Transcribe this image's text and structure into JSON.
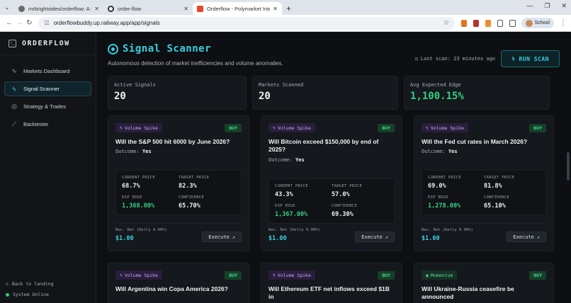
{
  "browser": {
    "tabs": [
      {
        "title": "mrbrightsides/orderflow: A live",
        "active": false,
        "fav_color": "#6b6b6b"
      },
      {
        "title": "order-flow",
        "active": false,
        "fav_color": "#333333"
      },
      {
        "title": "Orderflow - Polymarket Intellig",
        "active": true,
        "fav_color": "#e8452a"
      }
    ],
    "url": "orderflowbuddy.up.railway.app/app/signals",
    "profile": "School"
  },
  "sidebar": {
    "brand": "ORDERFLOW",
    "items": [
      {
        "label": "Markets Dashboard",
        "icon": "activity-icon",
        "glyph": "∿",
        "active": false
      },
      {
        "label": "Signal Scanner",
        "icon": "zap-icon",
        "glyph": "ϟ",
        "active": true
      },
      {
        "label": "Strategy & Trades",
        "icon": "target-icon",
        "glyph": "◎",
        "active": false
      },
      {
        "label": "Backtester",
        "icon": "chart-icon",
        "glyph": "⟋",
        "active": false
      }
    ],
    "back_label": "Back to landing",
    "status_label": "System Online"
  },
  "header": {
    "title": "Signal Scanner",
    "subtitle": "Autonomous detection of market inefficiencies and volume anomalies.",
    "last_scan": "Last scan: 23 minutes ago",
    "run_label": "RUN SCAN"
  },
  "stats": [
    {
      "label": "Active Signals",
      "value": "20",
      "green": false
    },
    {
      "label": "Markets Scanned",
      "value": "20",
      "green": false
    },
    {
      "label": "Avg Expected Edge",
      "value": "1,100.15%",
      "green": true
    }
  ],
  "labels": {
    "current_price": "CURRENT PRICE",
    "target_price": "TARGET PRICE",
    "exp_edge": "EXP EDGE",
    "confidence": "CONFIDENCE",
    "rec_bet": "Rec. Bet (Kelly 0.00%)",
    "execute": "Execute",
    "outcome": "Outcome:"
  },
  "cards": [
    {
      "badge": "Volume Spike",
      "type": "vol",
      "action": "BUY",
      "question": "Will the S&P 500 hit 6000 by June 2026?",
      "outcome": "Yes",
      "current": "68.7%",
      "target": "82.3%",
      "edge": "1,368.00%",
      "confidence": "65.70%",
      "bet": "$1.00"
    },
    {
      "badge": "Volume Spike",
      "type": "vol",
      "action": "BUY",
      "question": "Will Bitcoin exceed $150,000 by end of 2025?",
      "outcome": "Yes",
      "current": "43.3%",
      "target": "57.0%",
      "edge": "1,367.00%",
      "confidence": "69.30%",
      "bet": "$1.00"
    },
    {
      "badge": "Volume Spike",
      "type": "vol",
      "action": "BUY",
      "question": "Will the Fed cut rates in March 2026?",
      "outcome": "Yes",
      "current": "69.0%",
      "target": "81.8%",
      "edge": "1,278.00%",
      "confidence": "65.10%",
      "bet": "$1.00"
    }
  ],
  "cards_row2": [
    {
      "badge": "Volume Spike",
      "type": "vol",
      "action": "BUY",
      "question": "Will Argentina win Copa America 2026?"
    },
    {
      "badge": "Volume Spike",
      "type": "vol",
      "action": "BUY",
      "question": "Will Ethereum ETF net inflows exceed $1B in"
    },
    {
      "badge": "Momentum",
      "type": "mom",
      "action": "BUY",
      "question": "Will Ukraine-Russia ceasefire be announced"
    }
  ]
}
